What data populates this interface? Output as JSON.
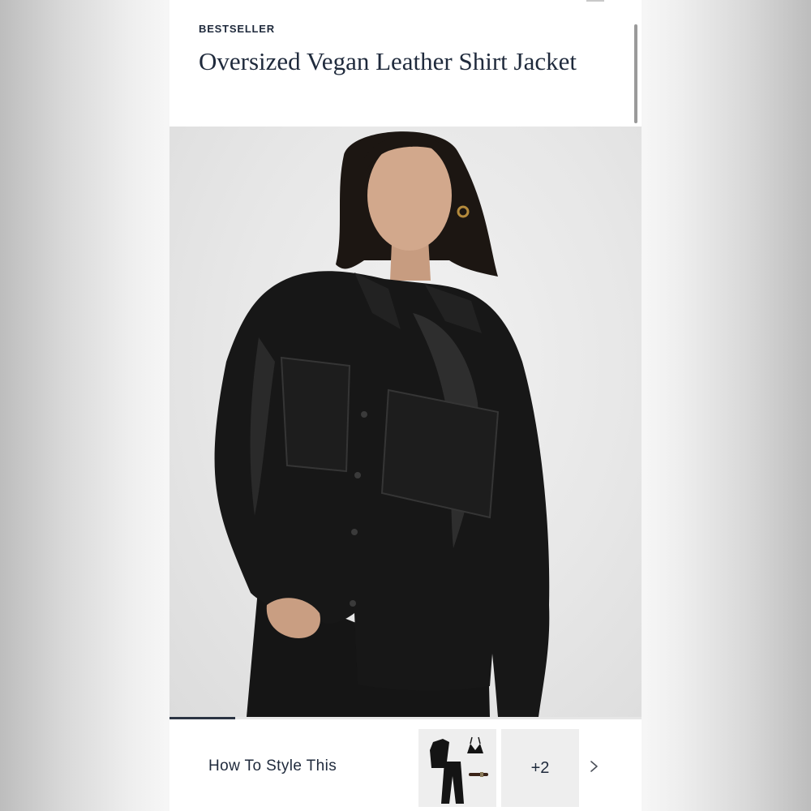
{
  "product": {
    "badge": "BESTSELLER",
    "title": "Oversized Vegan Leather Shirt Jacket"
  },
  "gallery": {
    "image_description_icon": "product-photo",
    "position_fraction": 0.14
  },
  "style_section": {
    "label": "How To Style This",
    "more_count": "+2",
    "next_icon": "chevron-right-icon"
  },
  "colors": {
    "text": "#1f2a3c",
    "progress": "#2b3443",
    "thumb_bg": "#eeeeee"
  }
}
